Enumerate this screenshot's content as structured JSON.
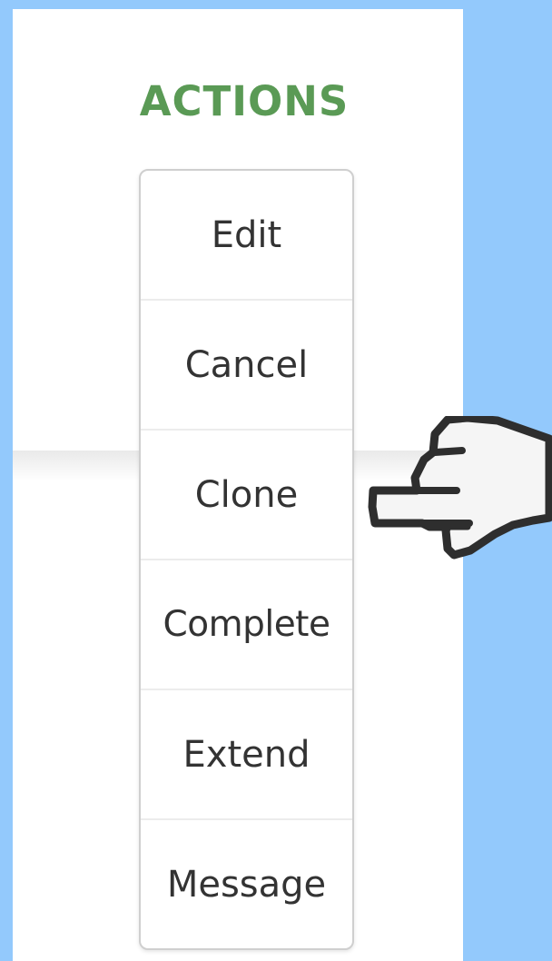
{
  "actions": {
    "title": "ACTIONS",
    "items": [
      {
        "label": "Edit"
      },
      {
        "label": "Cancel"
      },
      {
        "label": "Clone"
      },
      {
        "label": "Complete"
      },
      {
        "label": "Extend"
      },
      {
        "label": "Message"
      }
    ]
  },
  "cursor": {
    "icon": "pointing-hand-icon"
  },
  "colors": {
    "background": "#93c9fc",
    "panel": "#ffffff",
    "title": "#5a9a55",
    "menu_text": "#333333",
    "menu_border": "#cfcfcf"
  }
}
